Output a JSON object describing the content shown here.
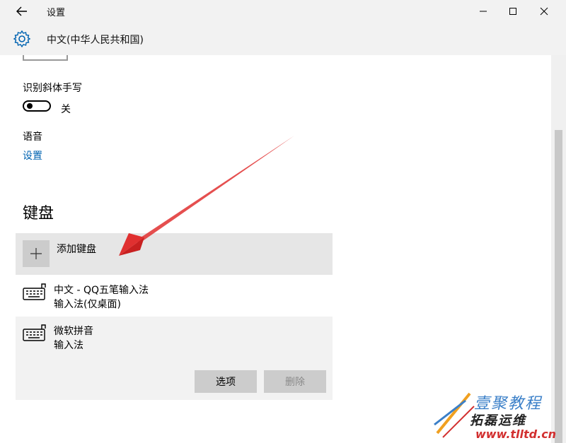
{
  "window": {
    "title": "设置",
    "header_title": "中文(中华人民共和国)"
  },
  "handwriting": {
    "label": "识别斜体手写",
    "toggle_state": "关"
  },
  "speech": {
    "label": "语音",
    "link": "设置"
  },
  "keyboard": {
    "section_title": "键盘",
    "add_label": "添加键盘",
    "items": [
      {
        "name": "中文 - QQ五笔输入法",
        "type": "输入法(仅桌面)"
      },
      {
        "name": "微软拼音",
        "type": "输入法"
      }
    ],
    "options_button": "选项",
    "delete_button": "删除"
  },
  "watermark": {
    "line1": "壹聚教程",
    "line2": "拓磊运维",
    "line3": "www.tlltd.cn"
  },
  "colors": {
    "accent": "#0063b1",
    "arrow": "#e03030"
  }
}
